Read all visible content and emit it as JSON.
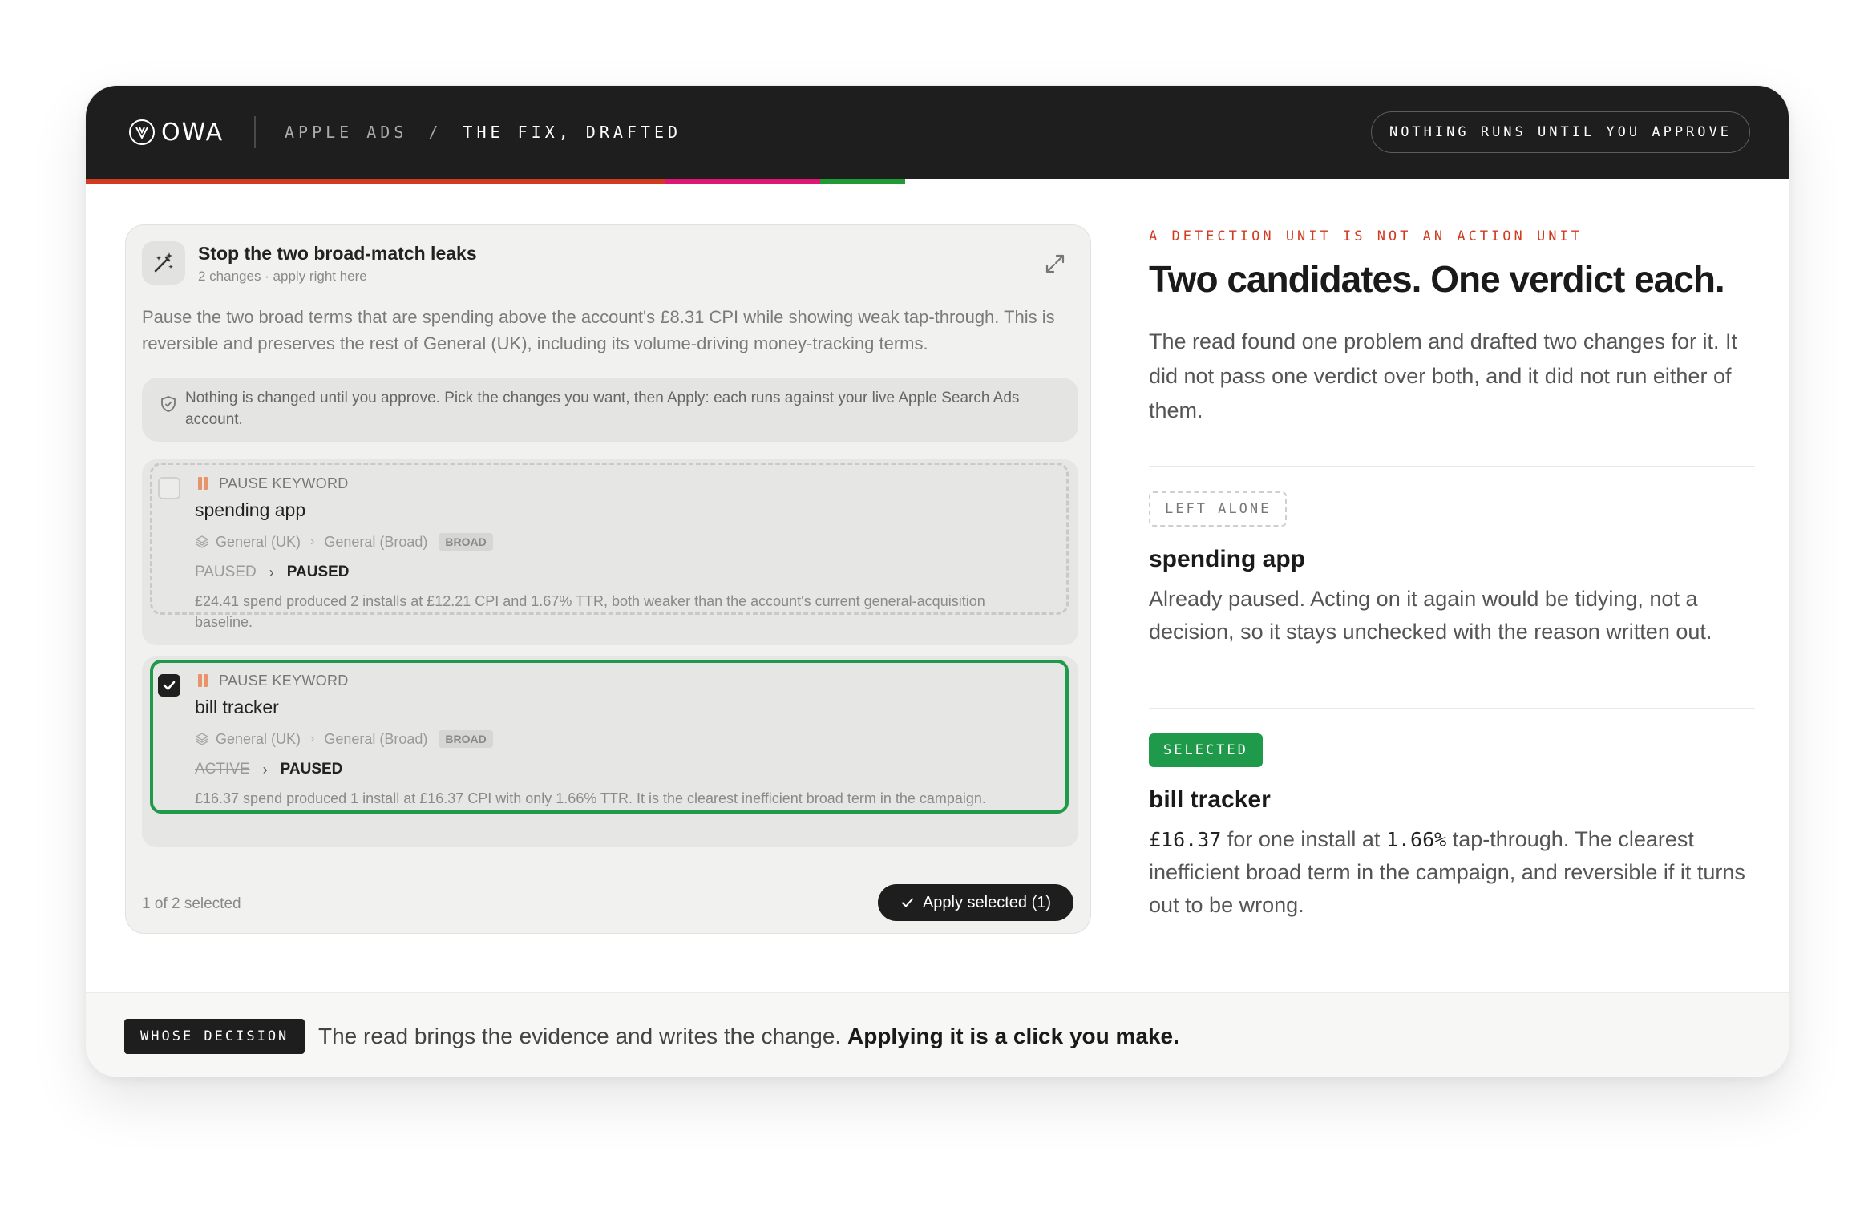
{
  "header": {
    "logo_text": "OWA",
    "breadcrumb_parent": "APPLE ADS",
    "breadcrumb_separator": "/",
    "breadcrumb_current": "THE FIX, DRAFTED",
    "approve_pill": "NOTHING RUNS UNTIL YOU APPROVE"
  },
  "progress_colors": {
    "red": "#d23a1f",
    "pink": "#e11673",
    "green": "#1f9a35"
  },
  "panel": {
    "title": "Stop the two broad-match leaks",
    "subtitle": "2 changes · apply right here",
    "description": "Pause the two broad terms that are spending above the account's £8.31 CPI while showing weak tap-through. This is reversible and preserves the rest of General (UK), including its volume-driving money-tracking terms.",
    "notice": "Nothing is changed until you approve. Pick the changes you want, then Apply: each runs against your live Apple Search Ads account.",
    "changes": [
      {
        "checked": false,
        "action": "PAUSE KEYWORD",
        "keyword": "spending app",
        "campaign": "General (UK)",
        "ad_group": "General (Broad)",
        "match_type": "BROAD",
        "old_state": "PAUSED",
        "new_state": "PAUSED",
        "reason": "£24.41 spend produced 2 installs at £12.21 CPI and 1.67% TTR, both weaker than the account's current general-acquisition baseline."
      },
      {
        "checked": true,
        "action": "PAUSE KEYWORD",
        "keyword": "bill tracker",
        "campaign": "General (UK)",
        "ad_group": "General (Broad)",
        "match_type": "BROAD",
        "old_state": "ACTIVE",
        "new_state": "PAUSED",
        "reason": "£16.37 spend produced 1 install at £16.37 CPI with only 1.66% TTR. It is the clearest inefficient broad term in the campaign."
      }
    ],
    "selected_count": "1 of 2 selected",
    "apply_label": "Apply selected (1)"
  },
  "right": {
    "eyebrow": "A DETECTION UNIT IS NOT AN ACTION UNIT",
    "headline": "Two candidates. One verdict each.",
    "intro": "The read found one problem and drafted two changes for it. It did not pass one verdict over both, and it did not run either of them.",
    "left_alone": {
      "tag": "LEFT ALONE",
      "title": "spending app",
      "body": "Already paused. Acting on it again would be tidying, not a decision, so it stays unchecked with the reason written out."
    },
    "selected": {
      "tag": "SELECTED",
      "title": "bill tracker",
      "amount": "£16.37",
      "body_a": " for one install at ",
      "rate": "1.66%",
      "body_b": " tap-through. The clearest inefficient broad term in the campaign, and reversible if it turns out to be wrong."
    }
  },
  "footer": {
    "badge": "WHOSE DECISION",
    "text": "The read brings the evidence and writes the change.",
    "text_bold": "Applying it is a click you make."
  }
}
